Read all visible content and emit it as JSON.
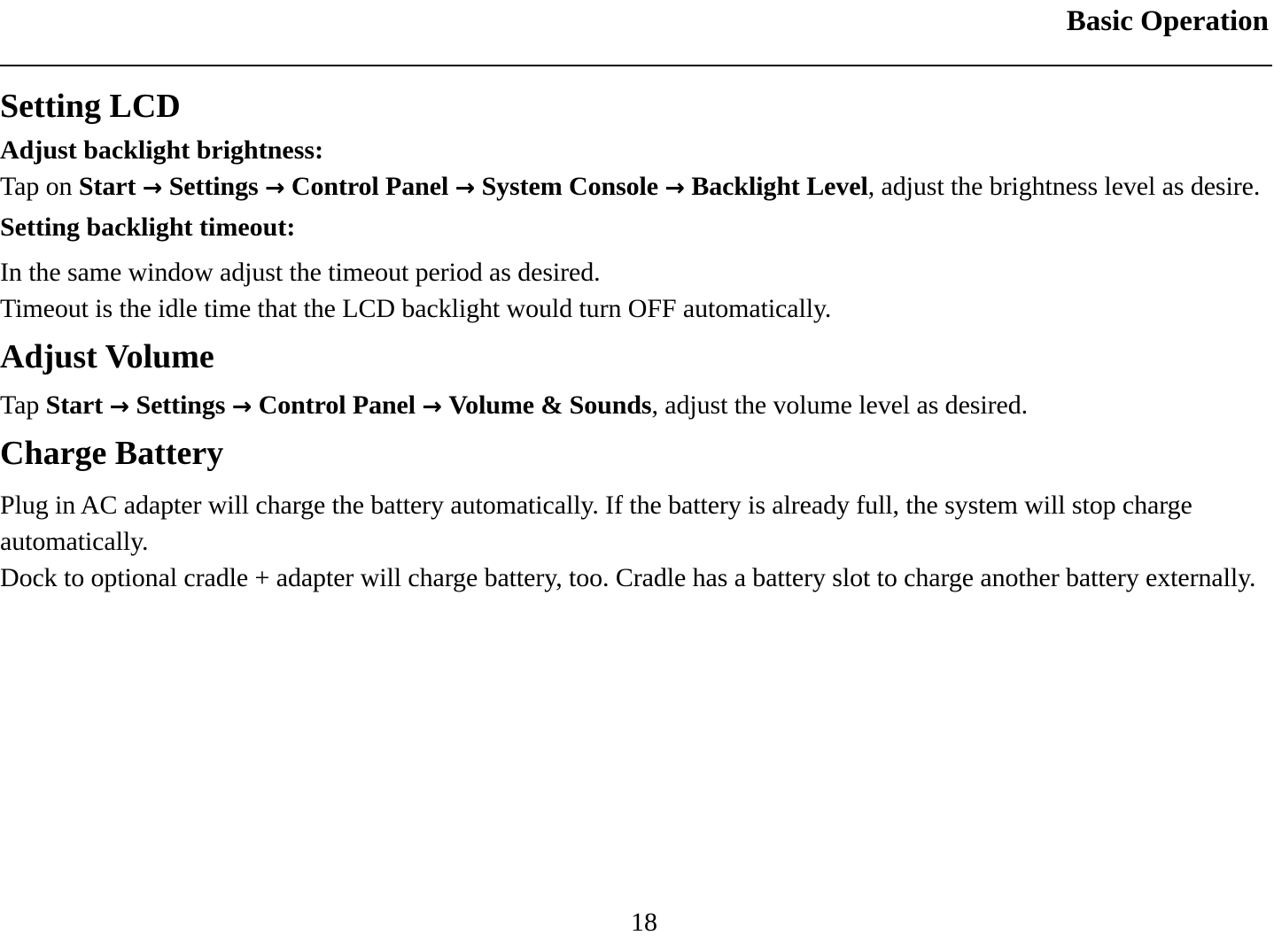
{
  "header": {
    "title": "Basic Operation"
  },
  "sections": [
    {
      "heading": "Setting LCD",
      "subheads": {
        "brightness": "Adjust backlight brightness:",
        "timeout": "Setting backlight timeout:"
      },
      "brightness_steps": {
        "lead": "Tap on ",
        "step1": "Start",
        "step2": "Settings",
        "step3": "Control Panel",
        "step4": "System Console",
        "step5": "Backlight Level",
        "tail": ", adjust the brightness level as desire."
      },
      "timeout_text_line1": "In the same window adjust the timeout period as desired.",
      "timeout_text_line2": "Timeout is the idle time that the LCD backlight would turn OFF automatically."
    },
    {
      "heading": "Adjust Volume",
      "volume_steps": {
        "lead": "Tap ",
        "step1": "Start",
        "step2": "Settings",
        "step3": "Control Panel",
        "step4": "Volume & Sounds",
        "tail": ", adjust the volume level as desired."
      }
    },
    {
      "heading": "Charge Battery",
      "paragraph1": "Plug in AC adapter will charge the battery automatically. If the battery is already full, the system will stop charge automatically.",
      "paragraph2": "Dock to optional cradle + adapter will charge battery, too. Cradle has a battery slot to charge another battery externally."
    }
  ],
  "arrow_glyph": "→",
  "footer": {
    "page_number": "18"
  }
}
